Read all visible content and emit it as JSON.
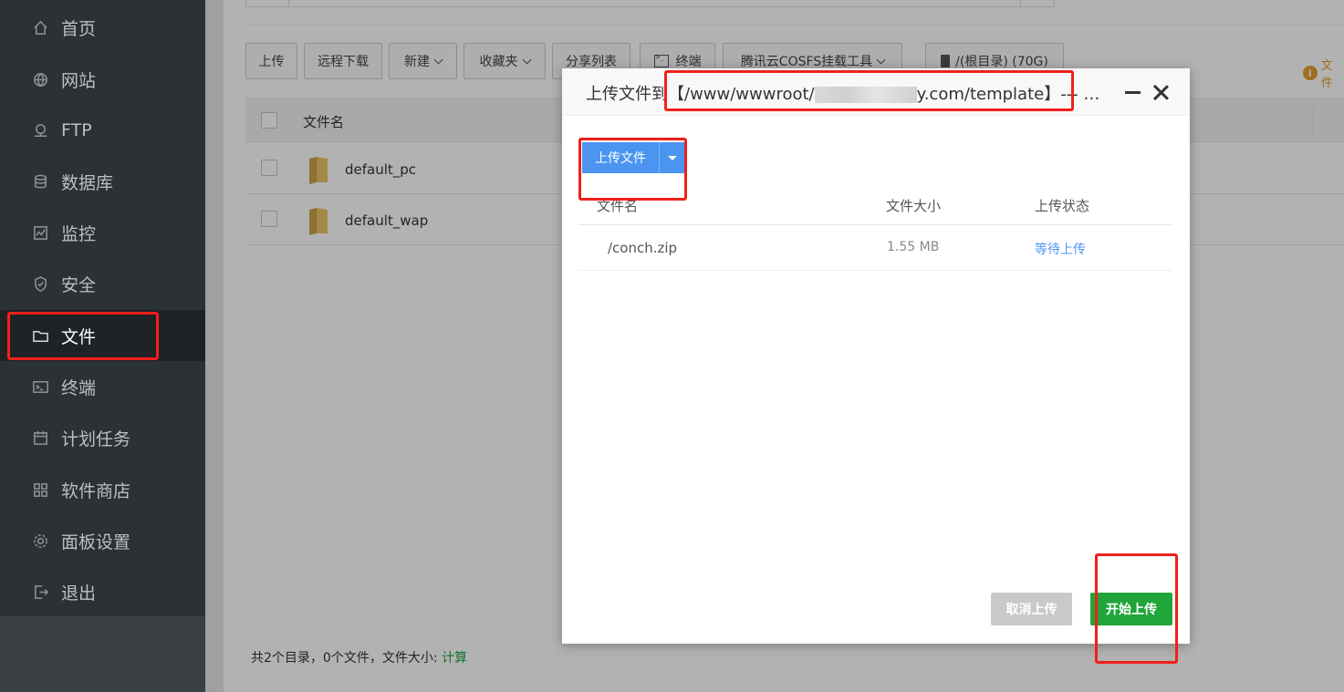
{
  "sidebar": {
    "items": [
      {
        "label": "首页",
        "icon": "home-icon"
      },
      {
        "label": "网站",
        "icon": "globe-icon"
      },
      {
        "label": "FTP",
        "icon": "ftp-icon"
      },
      {
        "label": "数据库",
        "icon": "database-icon"
      },
      {
        "label": "监控",
        "icon": "monitor-icon"
      },
      {
        "label": "安全",
        "icon": "shield-icon"
      },
      {
        "label": "文件",
        "icon": "folder-icon",
        "active": true
      },
      {
        "label": "终端",
        "icon": "terminal-icon"
      },
      {
        "label": "计划任务",
        "icon": "calendar-icon"
      },
      {
        "label": "软件商店",
        "icon": "apps-icon"
      },
      {
        "label": "面板设置",
        "icon": "gear-icon"
      },
      {
        "label": "退出",
        "icon": "logout-icon"
      }
    ]
  },
  "toolbar": {
    "upload": "上传",
    "remote_download": "远程下载",
    "new": "新建",
    "favorites": "收藏夹",
    "share_list": "分享列表",
    "terminal": "终端",
    "cosfs": "腾讯云COSFS挂载工具",
    "disk": "/(根目录) (70G)",
    "info_link": "文件"
  },
  "file_table": {
    "header_name": "文件名",
    "rows": [
      {
        "name": "default_pc"
      },
      {
        "name": "default_wap"
      }
    ]
  },
  "footer": {
    "summary": "共2个目录，0个文件，文件大小:",
    "calc": "计算"
  },
  "modal": {
    "title_prefix": "上传文件到【/www/wwwroot/",
    "title_suffix": "y.com/template】--- 支持断点续传",
    "upload_button": "上传文件",
    "columns": {
      "name": "文件名",
      "size": "文件大小",
      "status": "上传状态"
    },
    "files": [
      {
        "name": "/conch.zip",
        "size": "1.55 MB",
        "status": "等待上传"
      }
    ],
    "cancel_button": "取消上传",
    "start_button": "开始上传"
  },
  "colors": {
    "accent_green": "#20a53a",
    "accent_blue": "#4b95f1",
    "highlight_red": "#f0201a"
  }
}
